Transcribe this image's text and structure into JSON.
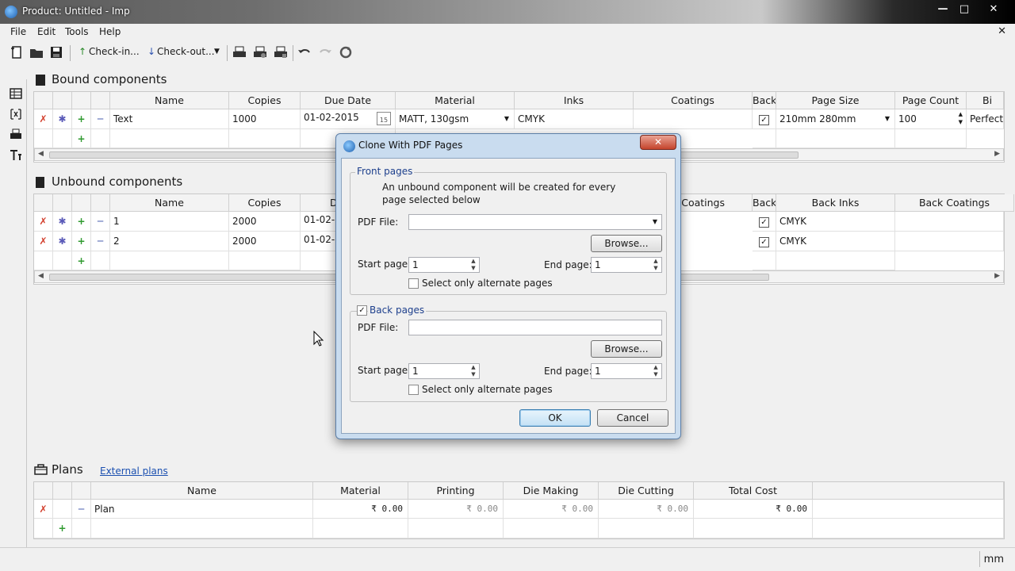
{
  "window": {
    "title": "Product: Untitled - Imp"
  },
  "menu": [
    "File",
    "Edit",
    "Tools",
    "Help"
  ],
  "toolbar": {
    "checkin": "Check-in...",
    "checkout": "Check-out..."
  },
  "bound": {
    "title": "Bound components",
    "headers": [
      "Name",
      "Copies",
      "Due Date",
      "Material",
      "Inks",
      "Coatings",
      "Back",
      "Page Size",
      "Page Count",
      "Bi"
    ],
    "row": {
      "name": "Text",
      "copies": "1000",
      "due": "01-02-2015",
      "material": "MATT, 130gsm",
      "inks": "CMYK",
      "page_size": "210mm 280mm",
      "page_count": "100",
      "binding": "Perfect"
    },
    "calendar_day": "15"
  },
  "unbound": {
    "title": "Unbound components",
    "headers": [
      "Name",
      "Copies",
      "Du",
      "t Coatings",
      "Back",
      "Back Inks",
      "Back Coatings"
    ],
    "rows": [
      {
        "name": "1",
        "copies": "2000",
        "due": "01-02-",
        "back_inks": "CMYK"
      },
      {
        "name": "2",
        "copies": "2000",
        "due": "01-02-",
        "back_inks": "CMYK"
      }
    ]
  },
  "plans": {
    "title": "Plans",
    "external_link": "External plans",
    "headers": [
      "Name",
      "Material",
      "Printing",
      "Die Making",
      "Die Cutting",
      "Total Cost"
    ],
    "row": {
      "name": "Plan",
      "material": "₹ 0.00",
      "printing": "₹ 0.00",
      "die_making": "₹ 0.00",
      "die_cutting": "₹ 0.00",
      "total": "₹ 0.00"
    }
  },
  "status": {
    "unit": "mm"
  },
  "dialog": {
    "title": "Clone With PDF Pages",
    "front": {
      "group": "Front pages",
      "info": "An unbound component will be created for every page selected below",
      "pdf_label": "PDF File:",
      "pdf_value": "",
      "browse": "Browse...",
      "start_label": "Start page:",
      "start_value": "1",
      "end_label": "End page:",
      "end_value": "1",
      "alternate": "Select only alternate pages"
    },
    "back": {
      "group": "Back pages",
      "pdf_label": "PDF File:",
      "pdf_value": "",
      "browse": "Browse...",
      "start_label": "Start page:",
      "start_value": "1",
      "end_label": "End page:",
      "end_value": "1",
      "alternate": "Select only alternate pages"
    },
    "ok": "OK",
    "cancel": "Cancel"
  }
}
